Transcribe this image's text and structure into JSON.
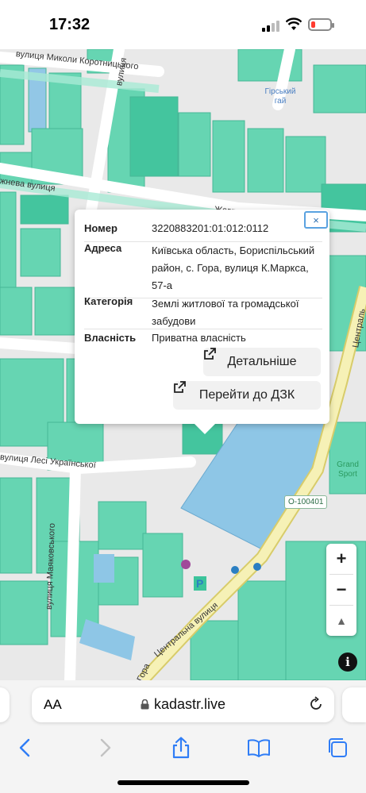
{
  "status": {
    "time": "17:32"
  },
  "map": {
    "streets": [
      "вулиця Миколи Коротницького",
      "вулиця",
      "жнева вулиця",
      "Жовтн",
      "вулиця Лесі Української",
      "вулиця Маяковського",
      "Центральна вулиця",
      "Централь",
      "Гора"
    ],
    "pois": {
      "park": "Гірський\nгай",
      "sport": "Grand\nSport"
    },
    "road_badge": "O-100401",
    "zoom_in": "+",
    "zoom_out": "−",
    "compass": "▲",
    "info": "i",
    "colors": {
      "parcel": "#5fd4b0",
      "parcel_dark": "#3cc49b",
      "water": "#8ec6e6",
      "road": "#f6f1b6",
      "road_edge": "#d8cc6a"
    }
  },
  "popup": {
    "close": "×",
    "rows": [
      {
        "key": "Номер",
        "value": "3220883201:01:012:0112"
      },
      {
        "key": "Адреса",
        "value": "Київська область, Бориспільський район, с. Гора, вулиця К.Маркса, 57-а"
      },
      {
        "key": "Категорія",
        "value": "Землі житлової та громадської забудови"
      },
      {
        "key": "Власність",
        "value": "Приватна власність"
      }
    ],
    "btn_details": "Детальніше",
    "btn_dzk": "Перейти до ДЗК"
  },
  "browser": {
    "aa_label": "AA",
    "url": "kadastr.live"
  }
}
